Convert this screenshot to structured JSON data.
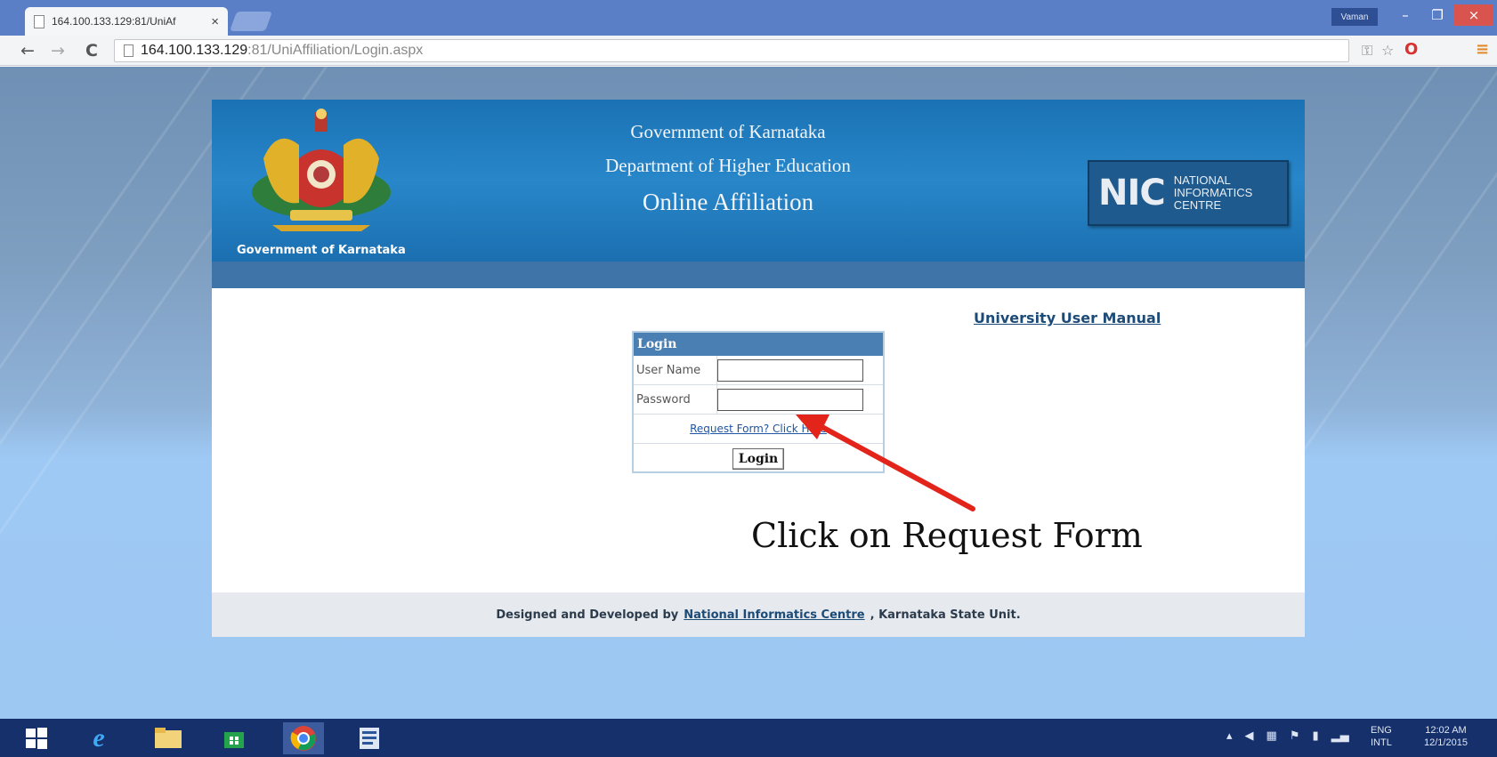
{
  "browser": {
    "tab_title": "164.100.133.129:81/UniAf",
    "tab_close": "×",
    "user_badge": "Vaman",
    "window_buttons": {
      "minimize": "–",
      "maximize": "❐",
      "close": "×"
    },
    "nav": {
      "back": "←",
      "forward": "→",
      "reload": "C"
    },
    "url_host": "164.100.133.129",
    "url_rest": ":81/UniAffiliation/Login.aspx",
    "toolbar_icons": [
      "key-icon",
      "star-icon",
      "opera-icon",
      "menu-icon"
    ]
  },
  "page": {
    "emblem_caption": "Government of Karnataka",
    "header_line1": "Government of Karnataka",
    "header_line2": "Department of Higher Education",
    "header_line3": "Online Affiliation",
    "nic_logo_word": "NIC",
    "nic_logo_line1": "NATIONAL",
    "nic_logo_line2": "INFORMATICS",
    "nic_logo_line3": "CENTRE",
    "manual_link": "University User Manual",
    "login": {
      "title": "Login",
      "username_label": "User Name",
      "username_value": "",
      "password_label": "Password",
      "password_value": "",
      "request_link": "Request Form? Click Here",
      "login_button": "Login"
    },
    "annotation_text": "Click on Request Form",
    "footer": {
      "prefix": "Designed and Developed by",
      "link": "National Informatics Centre",
      "suffix": ", Karnataka State Unit."
    }
  },
  "taskbar": {
    "apps": [
      "windows-start-icon",
      "internet-explorer-icon",
      "file-explorer-icon",
      "store-icon",
      "chrome-icon",
      "word-icon"
    ],
    "active_app": "chrome-icon",
    "lang_line1": "ENG",
    "lang_line2": "INTL",
    "time": "12:02 AM",
    "date": "12/1/2015"
  },
  "colors": {
    "header_blue": "#1a72b4",
    "login_header": "#4a7fb3",
    "annotation_arrow": "#e3241b",
    "taskbar": "#15306b"
  }
}
